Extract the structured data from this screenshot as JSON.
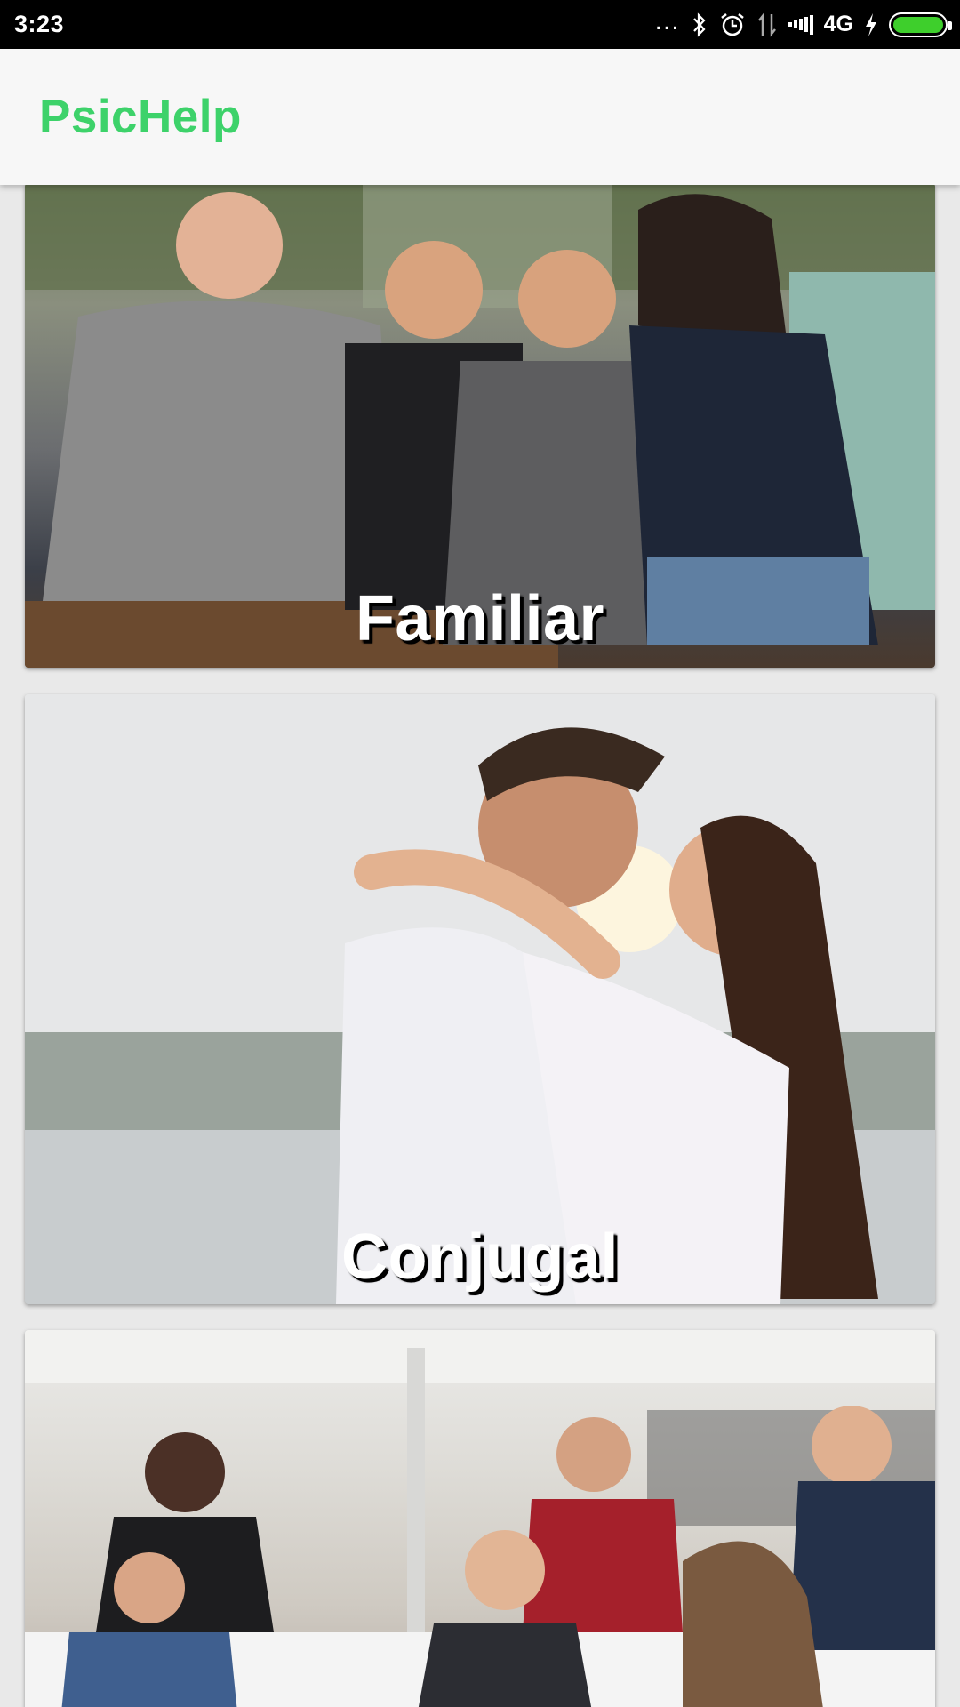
{
  "status_bar": {
    "time": "3:23",
    "more_label": "...",
    "network_label": "4G",
    "icons": [
      "more-dots-icon",
      "bluetooth-icon",
      "alarm-icon",
      "data-transfer-icon",
      "signal-icon",
      "charging-icon",
      "battery-icon"
    ],
    "battery_color": "#3ecf2c"
  },
  "app_bar": {
    "title": "PsicHelp",
    "title_color": "#3dd26a"
  },
  "cards": [
    {
      "title": "Familiar",
      "image": "family-photo"
    },
    {
      "title": "Conjugal",
      "image": "couple-photo"
    },
    {
      "title": "",
      "image": "group-photo"
    }
  ]
}
